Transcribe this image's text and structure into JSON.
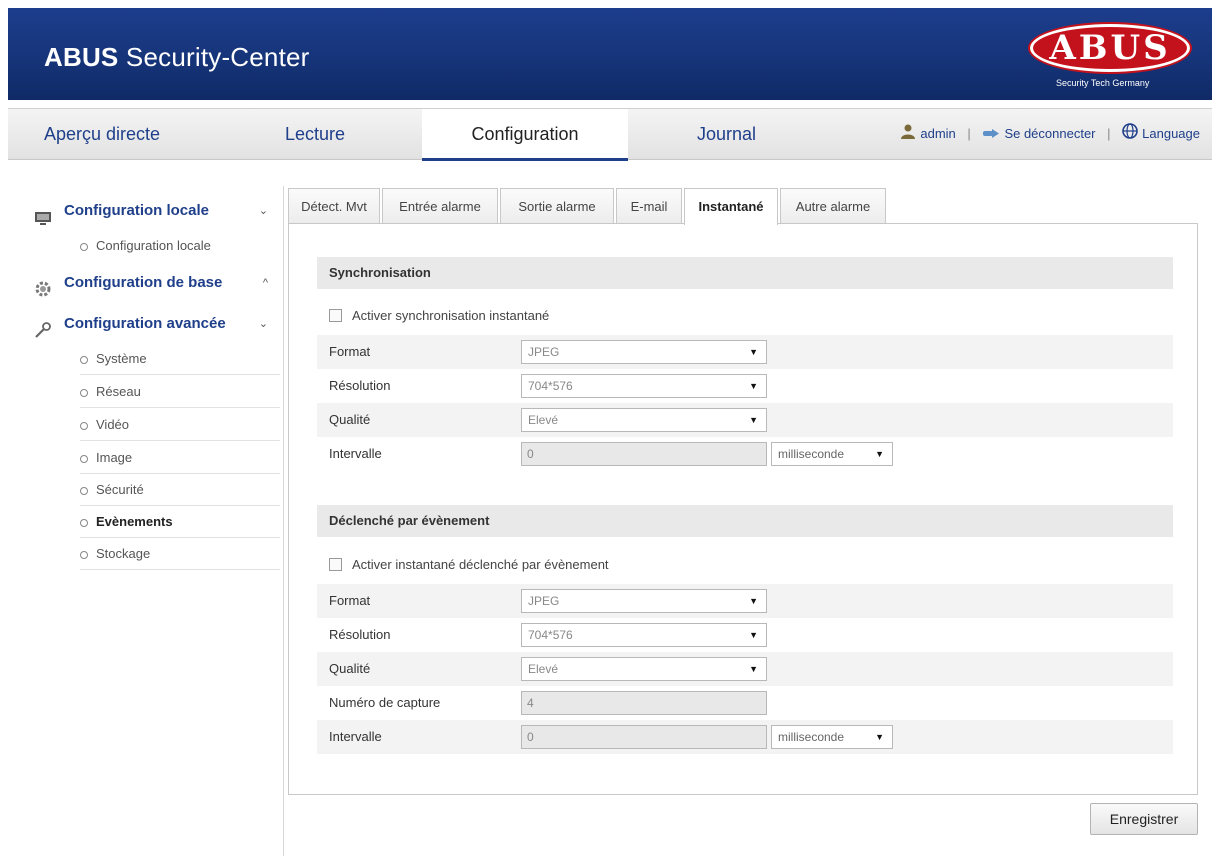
{
  "header": {
    "title_bold": "ABUS",
    "title_rest": "Security-Center",
    "logo_text": "ABUS",
    "logo_tagline": "Security Tech Germany",
    "colors": {
      "header_bg": "#163479",
      "logo_red": "#c4121d",
      "nav_text": "#1f3f8a"
    }
  },
  "nav": {
    "items": [
      {
        "label": "Aperçu directe"
      },
      {
        "label": "Lecture"
      },
      {
        "label": "Configuration"
      },
      {
        "label": "Journal"
      }
    ],
    "active": "Configuration",
    "user": "admin",
    "logout": "Se déconnecter",
    "language": "Language",
    "separator": "|",
    "icons": [
      "user-icon",
      "logout-icon",
      "globe-icon"
    ]
  },
  "sidebar": {
    "groups": [
      {
        "label": "Configuration locale",
        "icon": "monitor-icon",
        "chevron": "⌄",
        "items": [
          "Configuration locale"
        ]
      },
      {
        "label": "Configuration de base",
        "icon": "gear-icon",
        "chevron": "^",
        "items": []
      },
      {
        "label": "Configuration avancée",
        "icon": "wrench-icon",
        "chevron": "⌄",
        "items": [
          "Système",
          "Réseau",
          "Vidéo",
          "Image",
          "Sécurité",
          "Evènements",
          "Stockage"
        ]
      }
    ],
    "active_item": "Evènements"
  },
  "tabs": {
    "items": [
      "Détect. Mvt",
      "Entrée alarme",
      "Sortie alarme",
      "E-mail",
      "Instantané",
      "Autre alarme"
    ],
    "active": "Instantané"
  },
  "sync": {
    "title": "Synchronisation",
    "checkbox_label": "Activer synchronisation instantané",
    "checked": false,
    "fields": {
      "format_label": "Format",
      "format_value": "JPEG",
      "resolution_label": "Résolution",
      "resolution_value": "704*576",
      "quality_label": "Qualité",
      "quality_value": "Elevé",
      "interval_label": "Intervalle",
      "interval_value": "0",
      "interval_unit": "milliseconde"
    }
  },
  "event": {
    "title": "Déclenché par évènement",
    "checkbox_label": "Activer instantané déclenché par évènement",
    "checked": false,
    "fields": {
      "format_label": "Format",
      "format_value": "JPEG",
      "resolution_label": "Résolution",
      "resolution_value": "704*576",
      "quality_label": "Qualité",
      "quality_value": "Elevé",
      "capture_label": "Numéro de capture",
      "capture_value": "4",
      "interval_label": "Intervalle",
      "interval_value": "0",
      "interval_unit": "milliseconde"
    }
  },
  "actions": {
    "save_label": "Enregistrer"
  }
}
